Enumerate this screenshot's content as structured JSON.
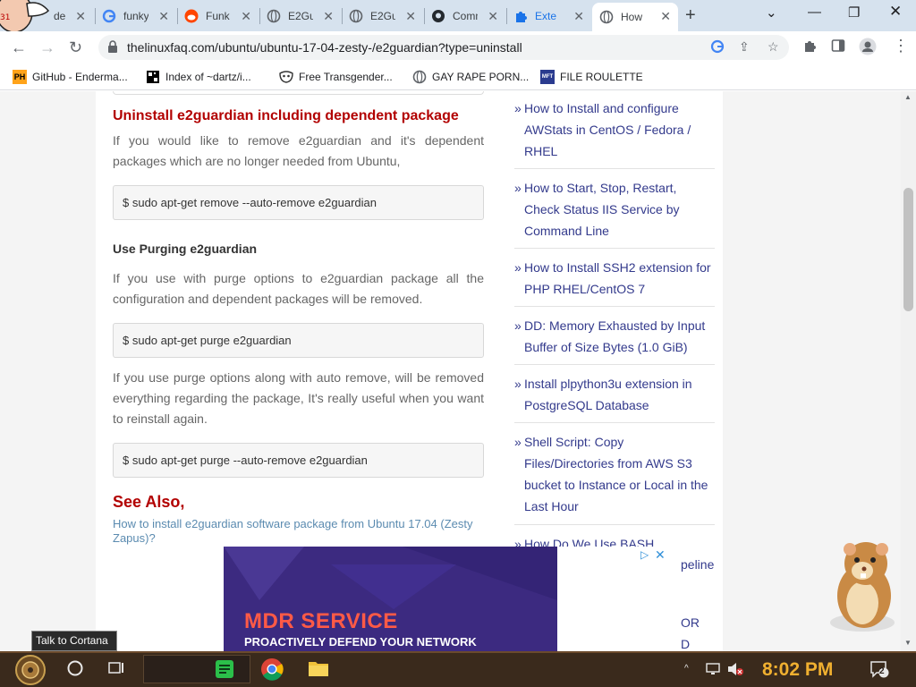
{
  "browser": {
    "tabs": [
      {
        "label": "de",
        "icon": "clip-icon",
        "active": false
      },
      {
        "label": "funky",
        "icon": "google-icon",
        "active": false
      },
      {
        "label": "Funk",
        "icon": "reddit-icon",
        "active": false
      },
      {
        "label": "E2Gu",
        "icon": "globe-icon",
        "active": false
      },
      {
        "label": "E2Gu",
        "icon": "globe-icon",
        "active": false
      },
      {
        "label": "Comm",
        "icon": "github-icon",
        "active": false
      },
      {
        "label": "Exte",
        "icon": "puzzle-icon",
        "active": false
      },
      {
        "label": "How",
        "icon": "globe-icon",
        "active": true
      }
    ],
    "url": "thelinuxfaq.com/ubuntu/ubuntu-17-04-zesty-/e2guardian?type=uninstall",
    "bookmarks": [
      {
        "label": "GitHub - Enderma...",
        "icon": "ph-icon",
        "badge": "PH"
      },
      {
        "label": "Index of ~dartz/i...",
        "icon": "qr-icon",
        "badge": ""
      },
      {
        "label": "Free Transgender...",
        "icon": "mask-icon",
        "badge": ""
      },
      {
        "label": "GAY RAPE PORN...",
        "icon": "globe-icon",
        "badge": ""
      },
      {
        "label": "FILE ROULETTE",
        "icon": "file-icon",
        "badge": "MFT"
      }
    ]
  },
  "article": {
    "heading_uninstall": "Uninstall e2guardian including dependent package",
    "para_uninstall": "If you would like to remove e2guardian and it's dependent packages which are no longer needed from Ubuntu,",
    "code_autoremove": "$ sudo apt-get remove --auto-remove e2guardian",
    "heading_purge": "Use Purging e2guardian",
    "para_purge": "If you use with purge options to e2guardian package all the configuration and dependent packages will be removed.",
    "code_purge": "$ sudo apt-get purge e2guardian",
    "para_purge_auto": "If you use purge options along with auto remove, will be removed everything regarding the package, It's really useful when you want to reinstall again.",
    "code_purge_auto": "$ sudo apt-get purge --auto-remove e2guardian",
    "see_also_heading": "See Also,",
    "see_also_link": "How to install e2guardian software package from Ubuntu 17.04 (Zesty Zapus)?"
  },
  "sidebar": {
    "marker": "»",
    "items": [
      "How to Install and configure AWStats in CentOS / Fedora / RHEL",
      "How to Start, Stop, Restart, Check Status IIS Service by Command Line",
      "How to Install SSH2 extension for PHP RHEL/CentOS 7",
      "DD: Memory Exhausted by Input Buffer of Size Bytes (1.0 GiB)",
      "Install plpython3u extension in PostgreSQL Database",
      "Shell Script: Copy Files/Directories from AWS S3 bucket to Instance or Local in the Last Hour",
      "How Do We Use BASH",
      "peline",
      "OR",
      "D"
    ]
  },
  "ad": {
    "title": "MDR SERVICE",
    "subtitle": "PROACTIVELY DEFEND YOUR NETWORK"
  },
  "taskbar": {
    "cortana_tooltip": "Talk to Cortana",
    "clock": "8:02 PM",
    "notification_count": "2"
  },
  "colors": {
    "heading_red": "#b20000",
    "sidebar_link": "#333a8c",
    "ad_background": "#3c2a80",
    "ad_title": "#ff5a46",
    "clock": "#f0b030"
  }
}
